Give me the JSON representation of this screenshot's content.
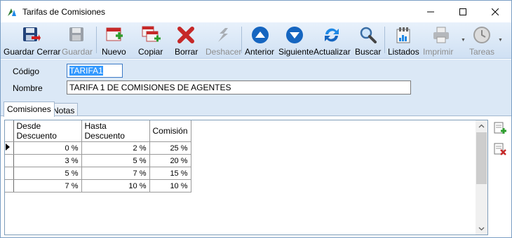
{
  "window": {
    "title": "Tarifas de Comisiones"
  },
  "toolbar": {
    "buttons": [
      {
        "label": "Guardar Cerrar",
        "icon": "save-close-icon",
        "enabled": true
      },
      {
        "label": "Guardar",
        "icon": "save-icon",
        "enabled": false
      },
      {
        "label": "Nuevo",
        "icon": "new-icon",
        "enabled": true
      },
      {
        "label": "Copiar",
        "icon": "copy-icon",
        "enabled": true
      },
      {
        "label": "Borrar",
        "icon": "delete-icon",
        "enabled": true
      },
      {
        "label": "Deshacer",
        "icon": "undo-icon",
        "enabled": false
      },
      {
        "label": "Anterior",
        "icon": "arrow-up-icon",
        "enabled": true
      },
      {
        "label": "Siguiente",
        "icon": "arrow-down-icon",
        "enabled": true
      },
      {
        "label": "Actualizar",
        "icon": "refresh-icon",
        "enabled": true
      },
      {
        "label": "Buscar",
        "icon": "search-icon",
        "enabled": true
      },
      {
        "label": "Listados",
        "icon": "reports-icon",
        "enabled": true
      },
      {
        "label": "Imprimir",
        "icon": "printer-icon",
        "enabled": false
      },
      {
        "label": "Tareas",
        "icon": "clock-icon",
        "enabled": false
      }
    ]
  },
  "form": {
    "codigo_label": "Código",
    "codigo_value": "TARIFA1",
    "nombre_label": "Nombre",
    "nombre_value": "TARIFA 1 DE COMISIONES DE AGENTES"
  },
  "tabs": [
    {
      "label": "Comisiones",
      "active": true
    },
    {
      "label": "Notas",
      "active": false
    }
  ],
  "grid": {
    "columns": [
      "Desde Descuento",
      "Hasta Descuento",
      "Comisión"
    ],
    "rows": [
      [
        "0 %",
        "2 %",
        "25 %"
      ],
      [
        "3 %",
        "5 %",
        "20 %"
      ],
      [
        "5 %",
        "7 %",
        "15 %"
      ],
      [
        "7 %",
        "10 %",
        "10 %"
      ]
    ],
    "current_row": 0
  },
  "colors": {
    "toolbar_top": "#e8f1fb",
    "toolbar_bottom": "#cfe0f3",
    "form_bg": "#dbe8f6",
    "selection": "#3399ff"
  }
}
